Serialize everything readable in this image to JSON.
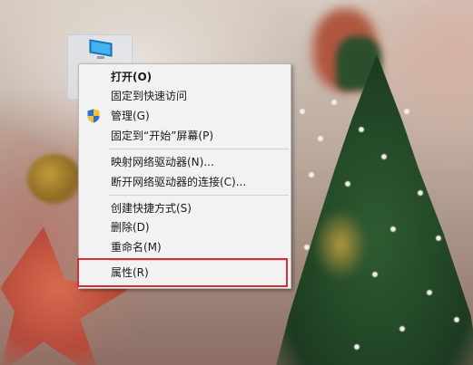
{
  "desktop": {
    "icon_name": "monitor-icon"
  },
  "context_menu": {
    "items": [
      {
        "label": "打开(O)",
        "bold": true
      },
      {
        "label": "固定到快速访问"
      },
      {
        "label": "管理(G)",
        "icon": "uac-shield-icon"
      },
      {
        "label": "固定到“开始”屏幕(P)"
      },
      {
        "label": "映射网络驱动器(N)..."
      },
      {
        "label": "断开网络驱动器的连接(C)..."
      },
      {
        "label": "创建快捷方式(S)"
      },
      {
        "label": "删除(D)"
      },
      {
        "label": "重命名(M)"
      },
      {
        "label": "属性(R)",
        "highlighted": true
      }
    ],
    "highlight_color": "#d52f35"
  }
}
